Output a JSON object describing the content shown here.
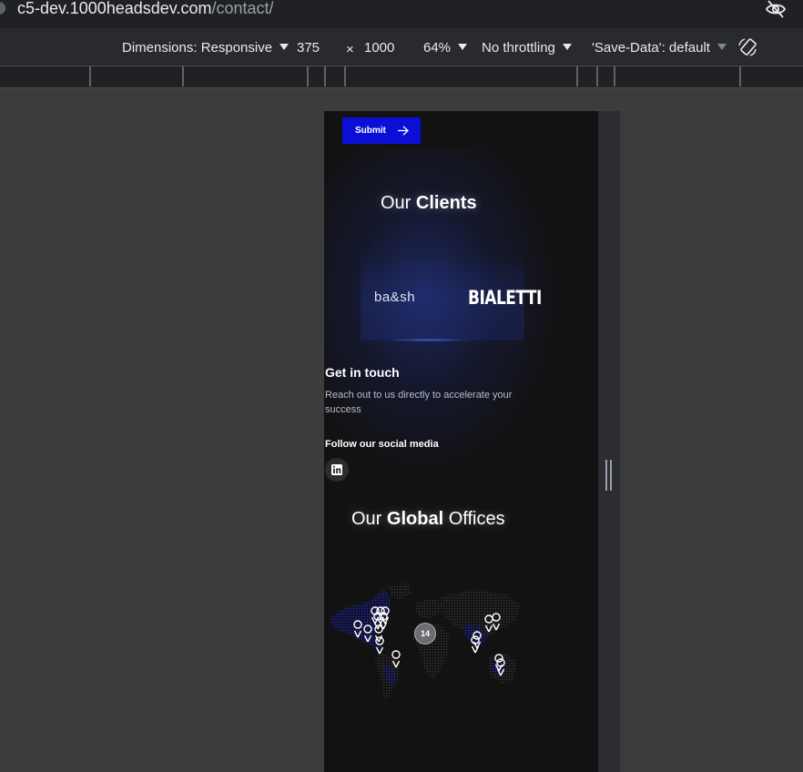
{
  "browser": {
    "url_main": "c5-dev.1000headsdev.com",
    "url_path": "/contact/",
    "icons": {
      "visibility": "eye-off-icon",
      "rotate": "rotate-icon"
    }
  },
  "device_toolbar": {
    "dimensions_label": "Dimensions: Responsive",
    "width": "375",
    "times": "×",
    "height": "1000",
    "zoom": "64%",
    "throttling": "No throttling",
    "save_data": "'Save-Data': default"
  },
  "page": {
    "submit_label": "Submit",
    "clients_title_prefix": "Our ",
    "clients_title_bold": "Clients",
    "logos": [
      "ba&sh",
      "BIALETTI"
    ],
    "get_in_touch_title": "Get in touch",
    "get_in_touch_text": "Reach out to us directly to accelerate your success",
    "follow_label": "Follow our social media",
    "social": [
      "linkedin-icon"
    ],
    "offices_title_prefix": "Our ",
    "offices_title_bold": "Global",
    "offices_title_suffix": " Offices",
    "map_cluster_count": "14"
  },
  "colors": {
    "accent": "#0b0fd6",
    "viewport_bg": "#121212",
    "devtools_bg": "#3c3c3c"
  }
}
